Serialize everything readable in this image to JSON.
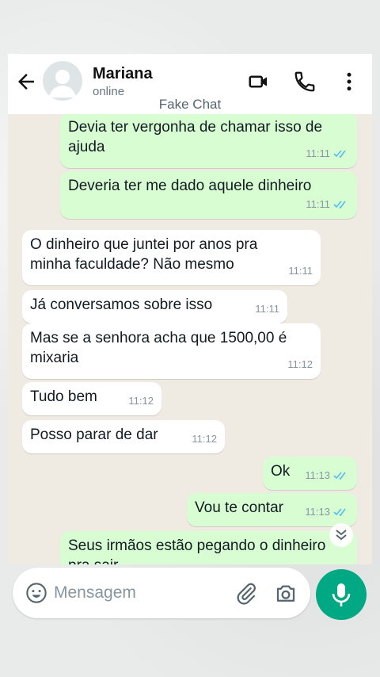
{
  "header": {
    "contact_name": "Mariana",
    "status": "online",
    "watermark": "Fake Chat",
    "icons": [
      "back-arrow-icon",
      "video-call-icon",
      "phone-icon",
      "more-options-icon"
    ]
  },
  "messages": [
    {
      "dir": "out",
      "text": "Devia ter vergonha de chamar isso de ajuda",
      "time": "11:11",
      "read": true
    },
    {
      "dir": "out",
      "text": "Deveria ter me dado aquele dinheiro",
      "time": "11:11",
      "read": true
    },
    {
      "dir": "in",
      "text": "O dinheiro que juntei por anos pra minha faculdade? Não mesmo",
      "time": "11:11"
    },
    {
      "dir": "in",
      "text": "Já conversamos sobre isso",
      "time": "11:11"
    },
    {
      "dir": "in",
      "text": "Mas se a senhora acha que 1500,00 é mixaria",
      "time": "11:12"
    },
    {
      "dir": "in",
      "text": "Tudo bem",
      "time": "11:12"
    },
    {
      "dir": "in",
      "text": "Posso parar de dar",
      "time": "11:12"
    },
    {
      "dir": "out",
      "text": "Ok",
      "time": "11:13",
      "read": true
    },
    {
      "dir": "out",
      "text": "Vou te contar",
      "time": "11:13",
      "read": true
    },
    {
      "dir": "out",
      "text": "Seus irmãos estão pegando o dinheiro pra sair",
      "time": ""
    }
  ],
  "composer": {
    "placeholder": "Mensagem"
  },
  "colors": {
    "accent": "#00a884",
    "outgoing_bubble": "#d9fdd3",
    "incoming_bubble": "#ffffff",
    "read_ticks": "#53bdeb"
  }
}
